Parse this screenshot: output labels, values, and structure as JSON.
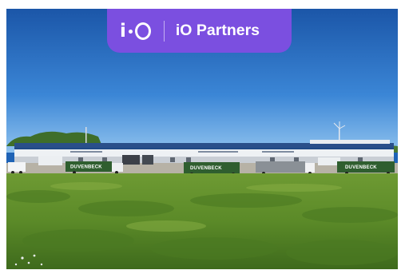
{
  "brand": {
    "logo_text": "i·O",
    "name": "iO Partners",
    "accent_color": "#7b4fe0"
  },
  "photo": {
    "trailer_labels": [
      "DUVENBECK",
      "DUVENBECK",
      "DUVENBECK"
    ],
    "sky_color": "#1f63b6",
    "grass_color": "#5f8a2a"
  }
}
